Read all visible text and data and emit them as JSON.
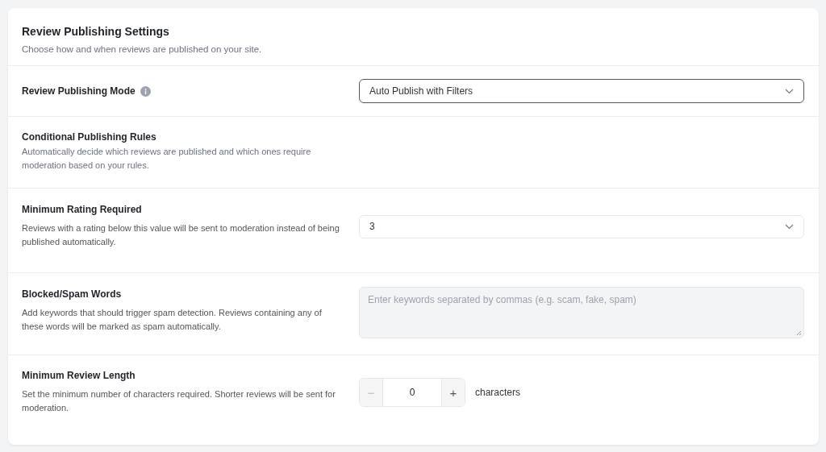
{
  "header": {
    "title": "Review Publishing Settings",
    "subtitle": "Choose how and when reviews are published on your site."
  },
  "rows": [
    {
      "kind": "select",
      "title": "Review Publishing Mode",
      "info": true,
      "value": "Auto Publish with Filters",
      "focused": true
    },
    {
      "kind": "heading",
      "title": "Conditional Publishing Rules",
      "description": "Automatically decide which reviews are published and which ones require moderation based on your rules."
    },
    {
      "kind": "select",
      "title": "Minimum Rating Required",
      "description": "Reviews with a rating below this value will be sent to moderation instead of being published automatically.",
      "value": "3",
      "focused": false
    },
    {
      "kind": "textarea",
      "title": "Blocked/Spam Words",
      "description": "Add keywords that should trigger spam detection. Reviews containing any of these words will be marked as spam automatically.",
      "placeholder": "Enter keywords separated by commas (e.g. scam, fake, spam)"
    },
    {
      "kind": "stepper",
      "title": "Minimum Review Length",
      "description": "Set the minimum number of characters required. Shorter reviews will be sent for moderation.",
      "decrement": "−",
      "increment": "+",
      "value": "0",
      "decrement_disabled": true,
      "unit": "characters"
    }
  ]
}
